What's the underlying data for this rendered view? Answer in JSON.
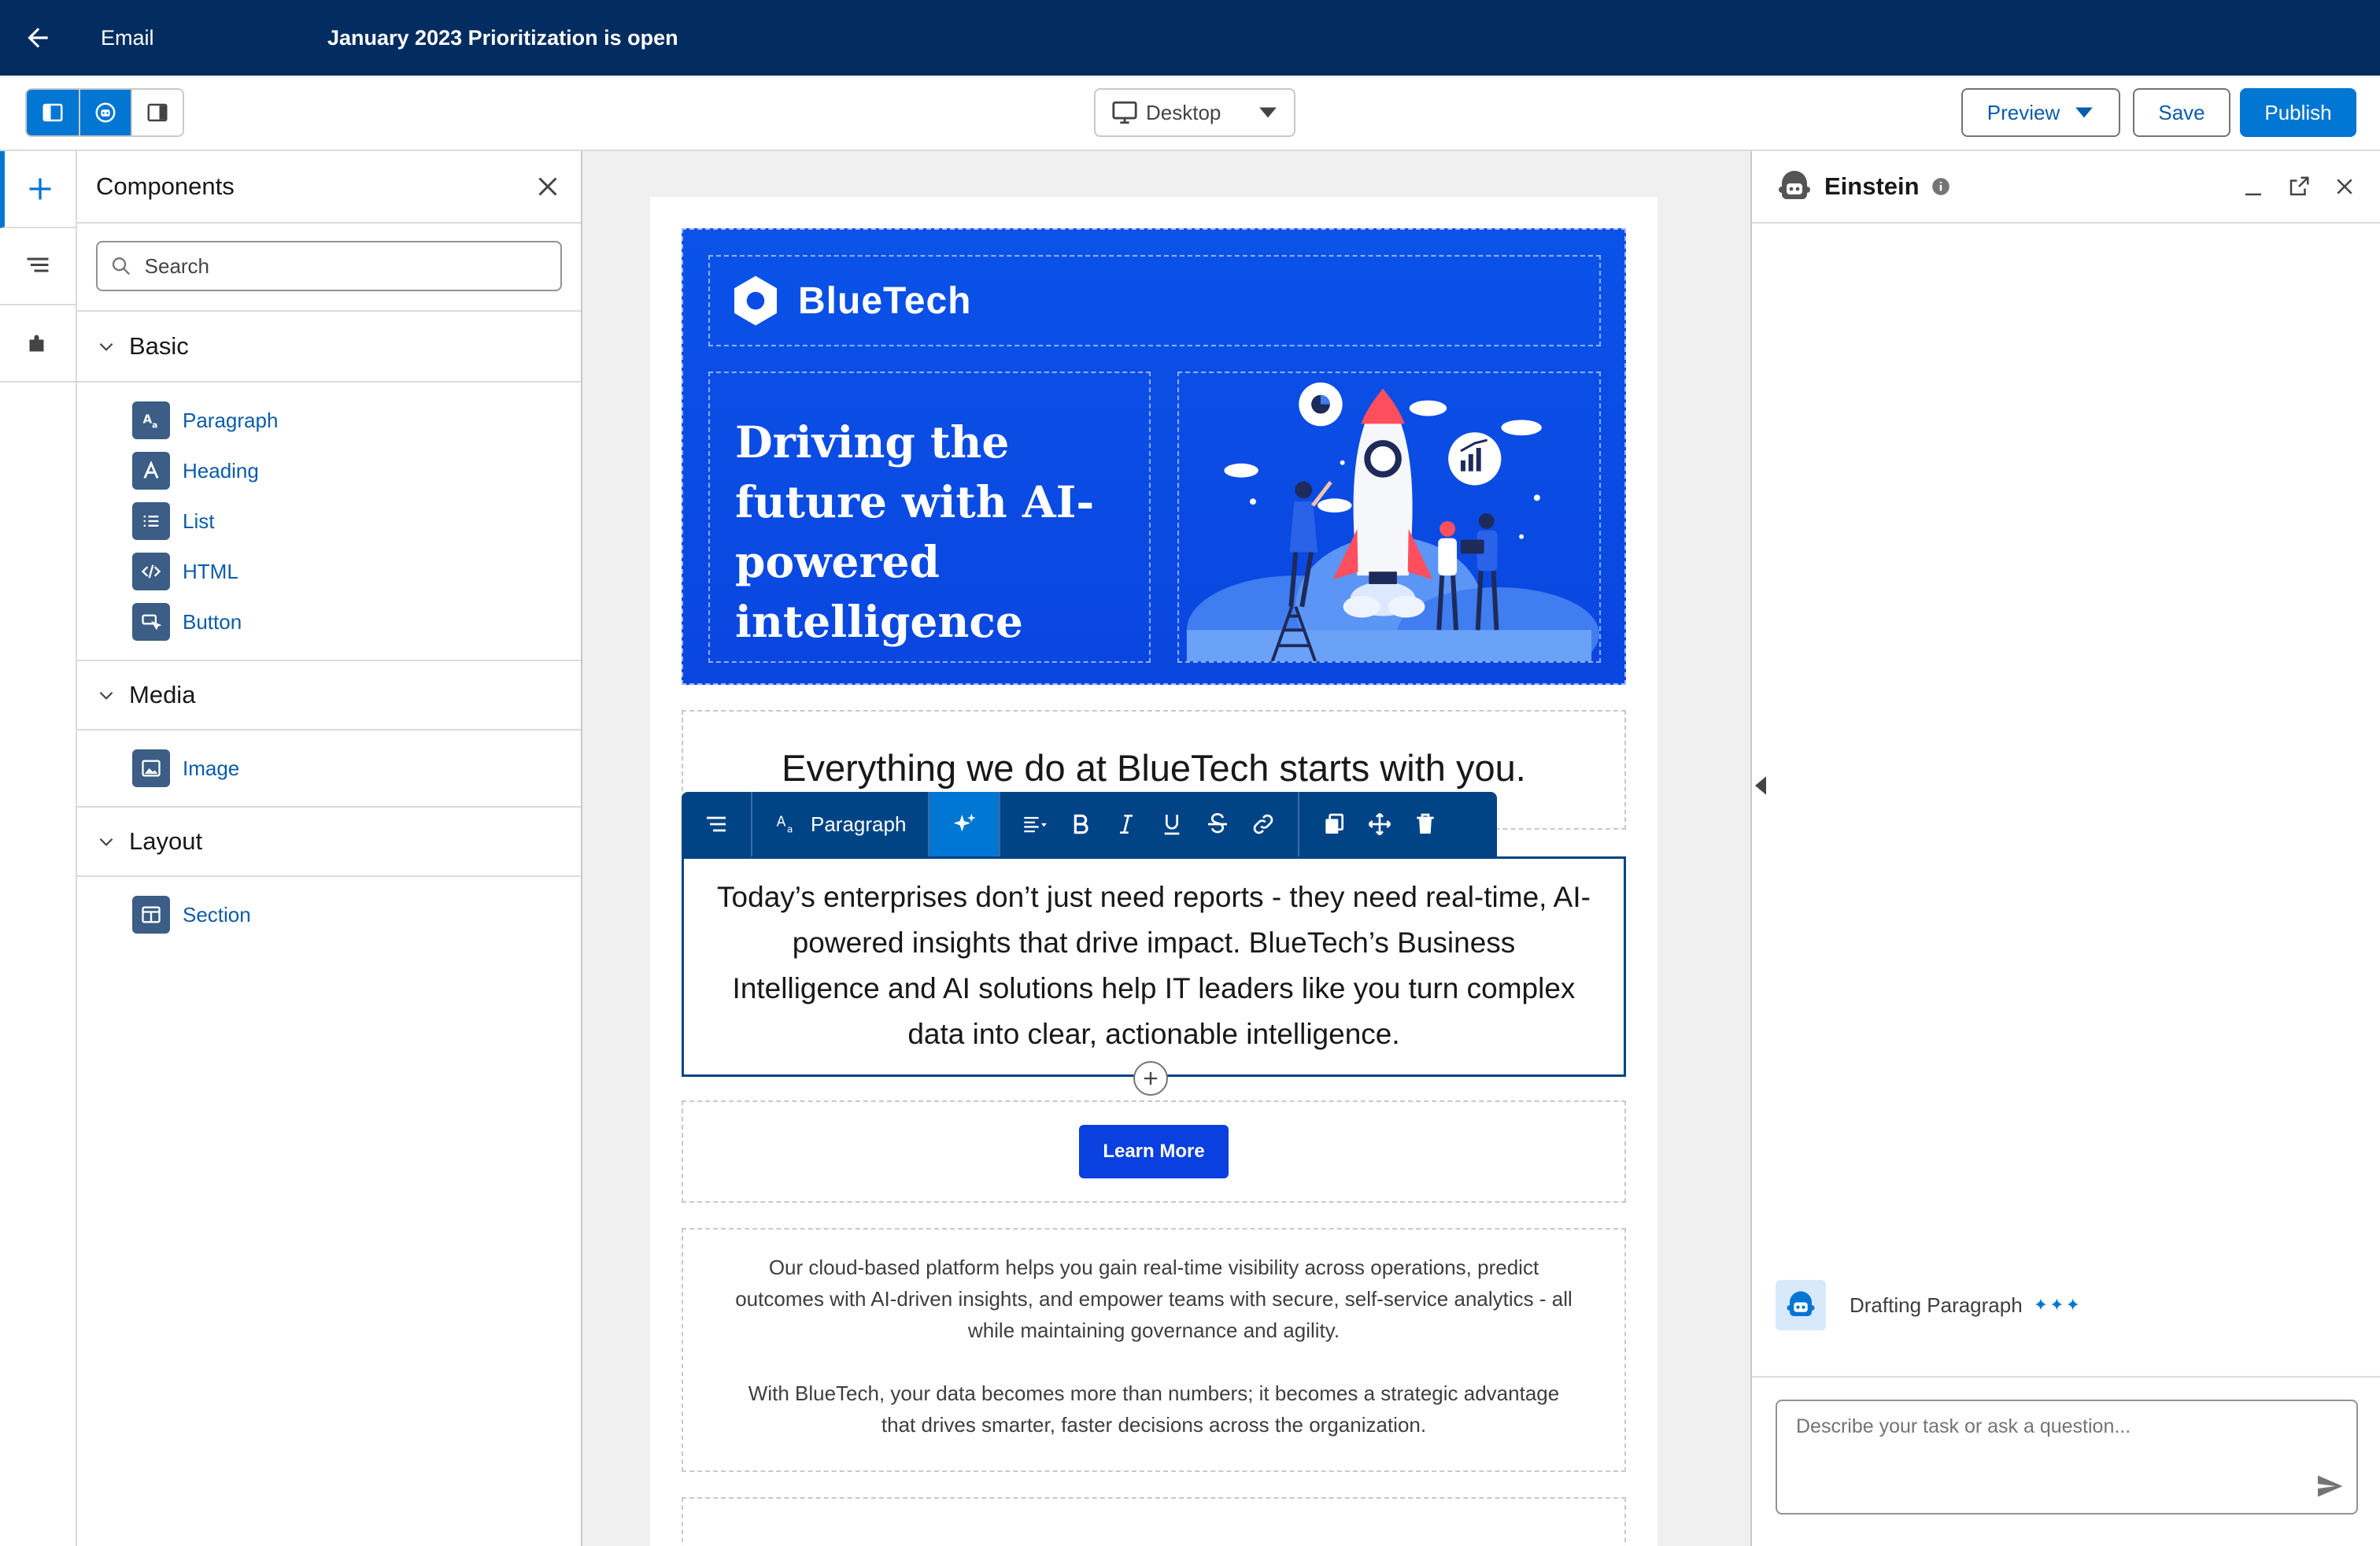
{
  "header": {
    "section_label": "Email",
    "title": "January 2023 Prioritization is open"
  },
  "toolbar": {
    "device_selected": "Desktop",
    "preview_label": "Preview",
    "save_label": "Save",
    "publish_label": "Publish"
  },
  "components_panel": {
    "title": "Components",
    "search_placeholder": "Search",
    "groups": [
      {
        "title": "Basic",
        "items": [
          {
            "label": "Paragraph",
            "icon": "paragraph-icon"
          },
          {
            "label": "Heading",
            "icon": "heading-icon"
          },
          {
            "label": "List",
            "icon": "list-icon"
          },
          {
            "label": "HTML",
            "icon": "html-icon"
          },
          {
            "label": "Button",
            "icon": "button-icon"
          }
        ]
      },
      {
        "title": "Media",
        "items": [
          {
            "label": "Image",
            "icon": "image-icon"
          }
        ]
      },
      {
        "title": "Layout",
        "items": [
          {
            "label": "Section",
            "icon": "section-icon"
          }
        ]
      }
    ]
  },
  "email": {
    "brand_name": "BlueTech",
    "hero_headline": "Driving the future with AI-powered intelligence",
    "heading": "Everything we do at BlueTech starts with you.",
    "paragraph": "Today’s enterprises don’t just need reports - they need real-time, AI-powered insights that drive impact. BlueTech’s Business Intelligence and AI solutions help IT leaders like you turn complex data into clear, actionable intelligence.",
    "cta_label": "Learn More",
    "body_text_1": "Our cloud-based platform helps you gain real-time visibility across operations, predict outcomes with AI-driven insights, and empower teams with secure, self-service analytics - all while maintaining governance and agility.",
    "body_text_2": "With BlueTech, your data becomes more than numbers; it becomes a strategic advantage that drives smarter, faster decisions across the organization."
  },
  "rte_toolbar": {
    "block_type": "Paragraph"
  },
  "einstein": {
    "title": "Einstein",
    "status": "Drafting Paragraph",
    "input_placeholder": "Describe your task or ask a question..."
  },
  "colors": {
    "header_bg": "#032d60",
    "brand_blue": "#0176d3",
    "link_blue": "#0b5cab",
    "hero_blue": "#0a4ce6",
    "rte_toolbar_bg": "#014486"
  }
}
